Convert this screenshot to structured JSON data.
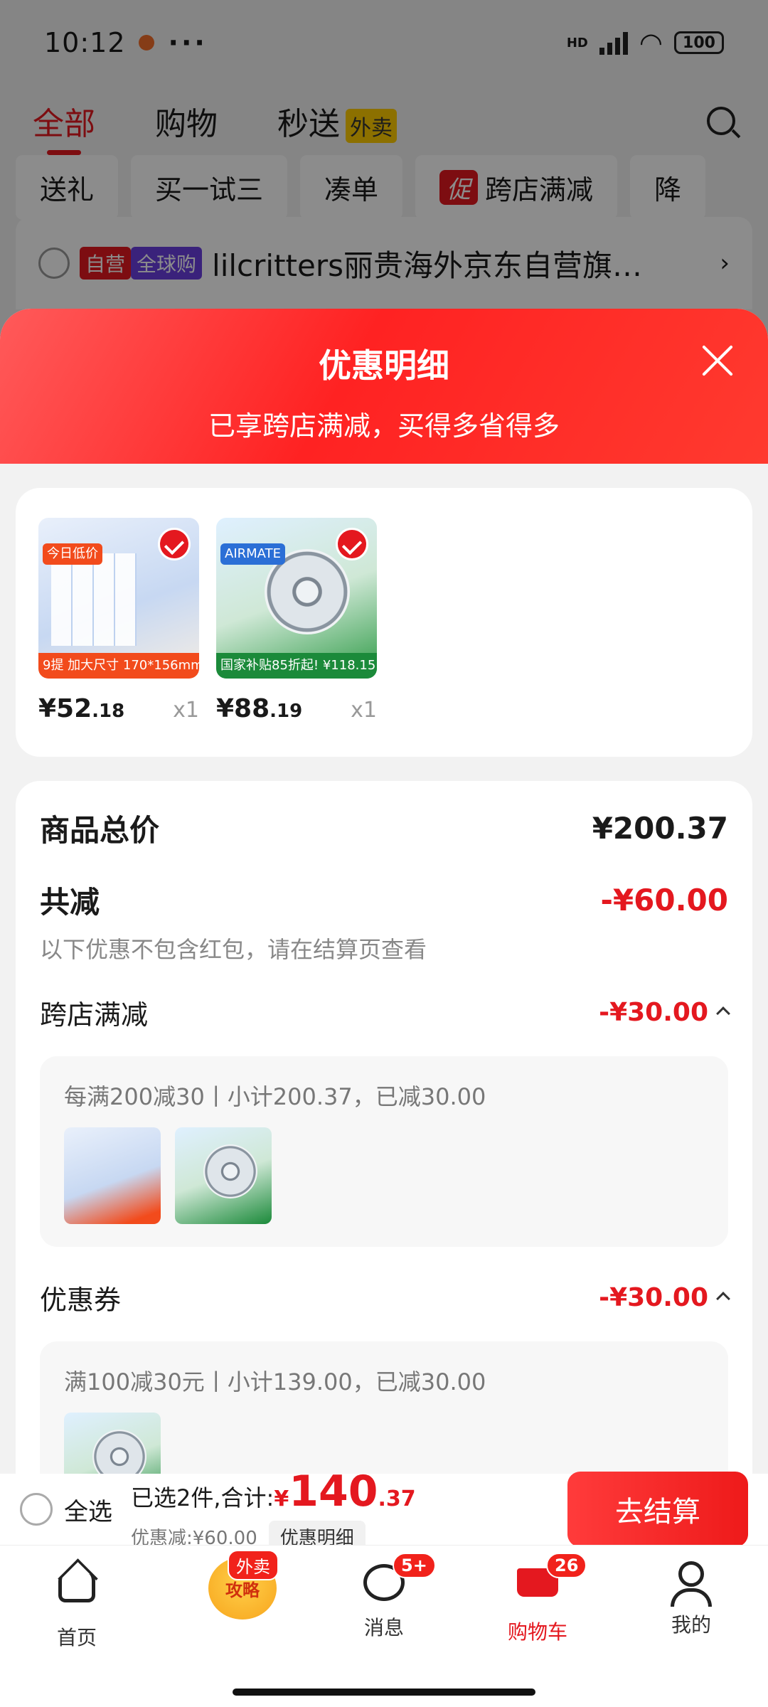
{
  "status_bar": {
    "time": "10:12",
    "battery": "100",
    "network": "HD"
  },
  "top_nav": {
    "tabs": [
      {
        "label": "全部",
        "active": true
      },
      {
        "label": "购物",
        "active": false
      },
      {
        "label": "秒送",
        "active": false
      }
    ],
    "takeaway_badge": "外卖"
  },
  "filter_chips": [
    {
      "label": "送礼"
    },
    {
      "label": "买一试三"
    },
    {
      "label": "凑单"
    },
    {
      "prefix": "促",
      "label": "跨店满减"
    },
    {
      "label": "降"
    }
  ],
  "shop_row": {
    "tag_self": "自营",
    "tag_global": "全球购",
    "name": "lilcritters丽贵海外京东自营旗…"
  },
  "sheet": {
    "title": "优惠明细",
    "subtitle": "已享跨店满减，买得多省得多",
    "products": [
      {
        "price_main": "¥52",
        "price_dec": ".18",
        "qty": "x1",
        "thumb_label": "9提 加大尺寸 170*156mm",
        "thumb_badge": "今日低价"
      },
      {
        "price_main": "¥88",
        "price_dec": ".19",
        "qty": "x1",
        "thumb_label": "国家补贴85折起! ¥118.15",
        "thumb_badge": "AIRMATE"
      }
    ],
    "summary": {
      "total_label": "商品总价",
      "total_value": "¥200.37",
      "discount_label": "共减",
      "discount_value": "-¥60.00",
      "note": "以下优惠不包含红包，请在结算页查看",
      "sections": [
        {
          "label": "跨店满减",
          "value": "-¥30.00",
          "detail": "每满200减30丨小计200.37，已减30.00",
          "items": 2
        },
        {
          "label": "优惠券",
          "value": "-¥30.00",
          "detail": "满100减30元丨小计139.00，已减30.00",
          "items": 1
        }
      ]
    }
  },
  "checkout": {
    "select_all": "全选",
    "selected_text": "已选2件,合计:",
    "currency": "¥",
    "total_int": "140",
    "total_dec": ".37",
    "discount_text": "优惠减:¥60.00",
    "detail_button": "优惠明细",
    "submit_button": "去结算"
  },
  "tab_bar": {
    "items": [
      {
        "label": "首页",
        "icon": "home-icon"
      },
      {
        "label": "攻略",
        "icon": "guide-icon",
        "badge": "外卖"
      },
      {
        "label": "消息",
        "icon": "message-icon",
        "badge": "5+"
      },
      {
        "label": "购物车",
        "icon": "cart-icon",
        "badge": "26",
        "active": true
      },
      {
        "label": "我的",
        "icon": "profile-icon"
      }
    ]
  },
  "colors": {
    "accent": "#e4181f",
    "takeaway": "#ffcc00",
    "global_tag": "#6b3fe0"
  }
}
